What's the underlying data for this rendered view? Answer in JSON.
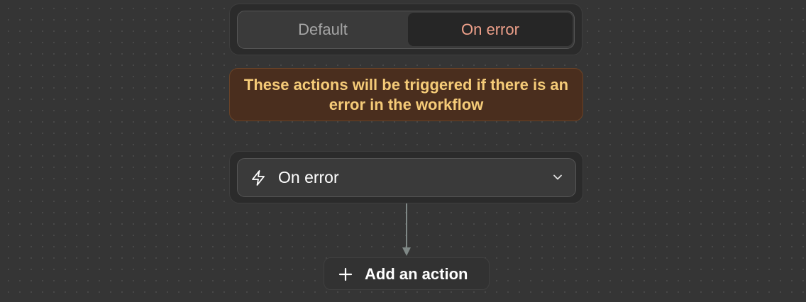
{
  "tabs": {
    "default_label": "Default",
    "on_error_label": "On error",
    "active": "On error"
  },
  "banner": {
    "text": "These actions will be triggered if there is an error in the workflow"
  },
  "trigger": {
    "icon": "lightning-bolt-icon",
    "label": "On error"
  },
  "add_action": {
    "icon": "plus-icon",
    "label": "Add an action"
  },
  "colors": {
    "background": "#353535",
    "active_tab_text": "#eea08a",
    "banner_background": "#4a2e1e",
    "banner_text": "#f5cb78"
  }
}
